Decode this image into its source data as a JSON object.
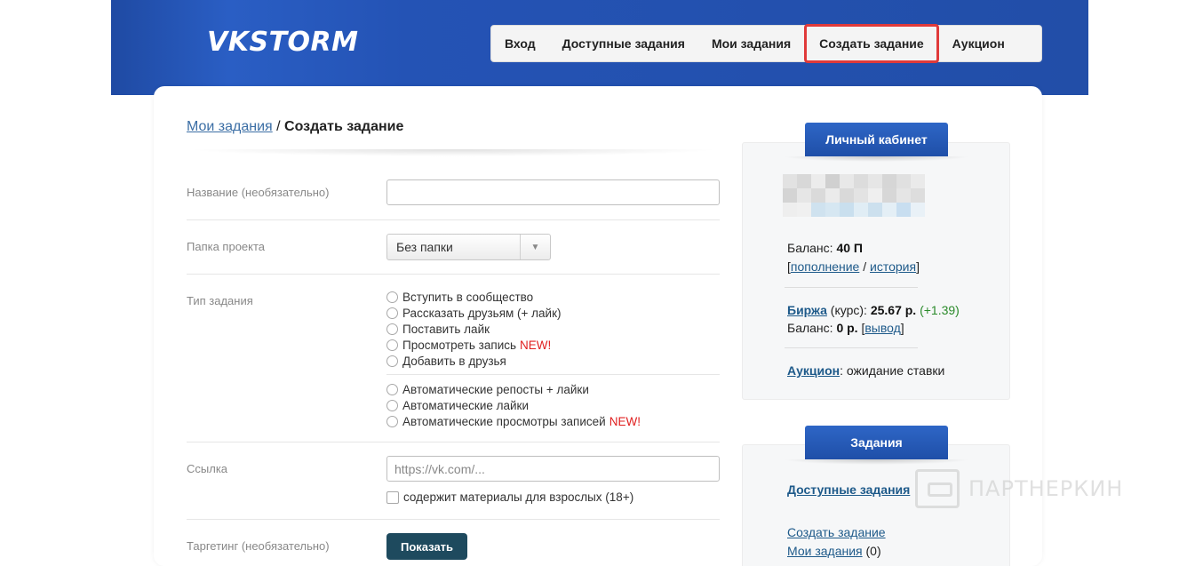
{
  "header": {
    "logo": "VKSTORM",
    "nav": [
      {
        "label": "Вход"
      },
      {
        "label": "Доступные задания"
      },
      {
        "label": "Мои задания"
      },
      {
        "label": "Создать задание"
      },
      {
        "label": "Аукцион"
      }
    ]
  },
  "breadcrumb": {
    "parent": "Мои задания",
    "separator": " / ",
    "current": "Создать задание"
  },
  "form": {
    "name_label": "Название (необязательно)",
    "name_value": "",
    "folder_label": "Папка проекта",
    "folder_value": "Без папки",
    "type_label": "Тип задания",
    "types_manual": [
      {
        "label": "Вступить в сообщество",
        "badge": ""
      },
      {
        "label": "Рассказать друзьям (+ лайк)",
        "badge": ""
      },
      {
        "label": "Поставить лайк",
        "badge": ""
      },
      {
        "label": "Просмотреть запись",
        "badge": "NEW!"
      },
      {
        "label": "Добавить в друзья",
        "badge": ""
      }
    ],
    "types_auto": [
      {
        "label": "Автоматические репосты + лайки",
        "badge": ""
      },
      {
        "label": "Автоматические лайки",
        "badge": ""
      },
      {
        "label": "Автоматические просмотры записей",
        "badge": "NEW!"
      }
    ],
    "link_label": "Ссылка",
    "link_placeholder": "https://vk.com/...",
    "adult_checkbox": "содержит материалы для взрослых (18+)",
    "targeting_label": "Таргетинг (необязательно)",
    "show_button": "Показать"
  },
  "cabinet": {
    "title": "Личный кабинет",
    "balance_label": "Баланс: ",
    "balance_value": "40 П",
    "topup_link": "пополнение",
    "history_link": "история",
    "exchange_link": "Биржа",
    "exchange_rate_label": " (курс): ",
    "exchange_rate": "25.67 р.",
    "exchange_delta": "(+1.39)",
    "rub_balance_label": "Баланс: ",
    "rub_balance_value": "0 р.",
    "withdraw_link": "вывод",
    "auction_link": "Аукцион",
    "auction_status": ": ожидание ставки"
  },
  "tasks_panel": {
    "title": "Задания",
    "available_link": "Доступные задания",
    "create_link": "Создать задание",
    "my_tasks_link": "Мои задания",
    "my_tasks_count": "(0)"
  },
  "watermark": "ПАРТНЕРКИН",
  "colors": {
    "header_blue": "#224ea8",
    "accent_red": "#e03a3a",
    "button_dark": "#1e4a5e",
    "link": "#1e5a8a",
    "new_badge": "#e02020"
  }
}
